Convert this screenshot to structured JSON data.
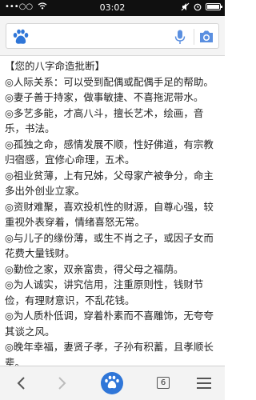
{
  "status_bar": {
    "carrier_signal": "•••○○",
    "time": "03:02"
  },
  "search": {
    "logo_text": "du"
  },
  "article": {
    "title": "【您的八字命造批断】",
    "paragraphs": [
      "◎人际关系：可以受到配偶或配偶手足的帮助。",
      "◎妻子善于持家，做事敏捷、不喜拖泥带水。",
      "◎多艺多能，才高八斗，擅长艺术，绘画，音乐，书法。",
      "◎孤独之命，感情发展不顺，性好佛道，有宗教归宿感，宜修心命理，五术。",
      "◎祖业贫薄，上有兄姊，父母家产被争分，命主多出外创业立家。",
      "◎资财难聚，喜欢投机性的财源，自尊心强，较重视外表穿着，情绪喜怒无常。",
      "◎与儿子的缘份薄，或生不肖之子，或因子女而花费大量钱财。",
      "◎勤俭之家，双亲富贵，得父母之福荫。",
      "◎为人诚实，讲究信用，注重原则性，钱财节俭，有理财意识，不乱花钱。",
      "◎为人质朴低调，穿着朴素而不喜雕饰，无夸夸其谈之风。",
      "◎晚年幸福，妻贤子孝，子孙有积蓄，且孝顺长辈。"
    ]
  },
  "bottom_bar": {
    "tab_count": "6"
  },
  "colors": {
    "status_bar_bg": "#101010",
    "accent_blue": "#2f76d8"
  }
}
